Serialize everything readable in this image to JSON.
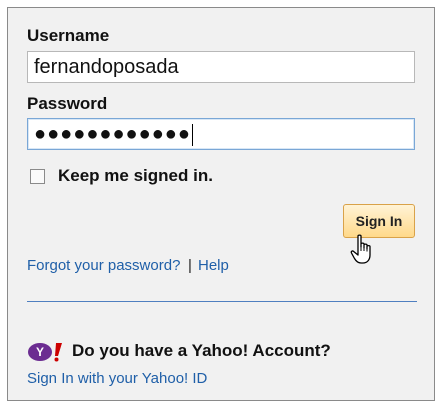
{
  "login": {
    "username_label": "Username",
    "username_value": "fernandoposada",
    "password_label": "Password",
    "password_mask": "●●●●●●●●●●●●",
    "keep_signed_in_label": "Keep me signed in.",
    "keep_signed_in_checked": false,
    "signin_button": "Sign In",
    "forgot_link": "Forgot your password?",
    "separator": "|",
    "help_link": "Help"
  },
  "yahoo": {
    "question": "Do you have a Yahoo! Account?",
    "signin_link": "Sign In with your Yahoo! ID"
  },
  "colors": {
    "link": "#1f5fa8",
    "divider": "#4f7fc0",
    "yahoo_purple": "#6b2c91",
    "button_border": "#d9a249"
  },
  "icons": [
    "hand-cursor-icon",
    "yahoo-logo-icon"
  ]
}
